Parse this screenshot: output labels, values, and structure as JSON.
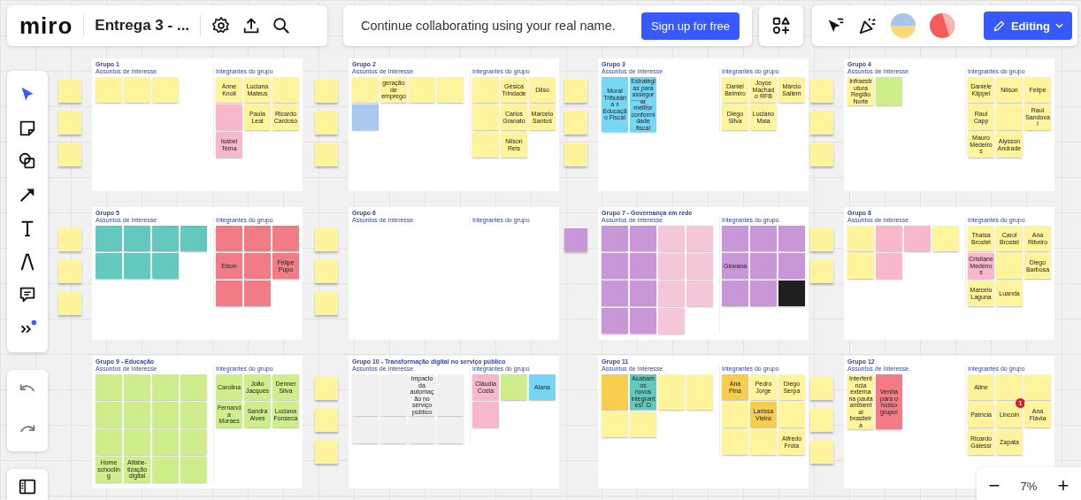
{
  "topbar": {
    "logo": "miro",
    "board_title": "Entrega 3 - ...",
    "banner": "Continue collaborating using your real name.",
    "signup": "Sign up for free",
    "mode": "Editing"
  },
  "frames": [
    {
      "title": "Grupo 1",
      "topics_label": "Assuntos de Interesse",
      "members_label": "Integrantes do grupo",
      "connector": false,
      "side_notes": [
        {
          "color": "#fdf49c"
        },
        {
          "color": "#fdf49c"
        },
        {
          "color": "#fdf49c"
        }
      ],
      "topics": [
        {
          "color": "#fdf49c"
        },
        {
          "color": "#fdf49c"
        },
        {
          "color": "#fdf49c"
        }
      ],
      "members": [
        {
          "text": "Anne Knoll",
          "color": "#fdf49c"
        },
        {
          "text": "Luciana Mateus",
          "color": "#fdf49c"
        },
        {
          "color": "#fdf49c"
        },
        {
          "color": "#f7b8cb"
        },
        {
          "text": "Paula Leal",
          "color": "#fdf49c"
        },
        {
          "text": "Ricardo Cardoso",
          "color": "#fdf49c"
        },
        {
          "text": "Isabel Tema",
          "color": "#f7b8cb"
        }
      ]
    },
    {
      "title": "Grupo 2",
      "topics_label": "Assuntos de Interesse",
      "members_label": "Integrantes do grupo",
      "connector": false,
      "side_notes": [
        {
          "color": "#fdf49c"
        },
        {
          "color": "#fdf49c"
        },
        {
          "color": "#fdf49c"
        }
      ],
      "topics": [
        {
          "color": "#fdf49c"
        },
        {
          "text": "geração de emprego",
          "color": "#fdf49c"
        },
        {
          "color": "#fdf49c"
        },
        {
          "color": "#fdf49c"
        },
        {
          "color": "#a9c9ef"
        }
      ],
      "members": [
        {
          "color": "#fdf49c"
        },
        {
          "text": "Gésica Trindade",
          "color": "#fdf49c"
        },
        {
          "text": "Dilso",
          "color": "#fdf49c"
        },
        {
          "color": "#fdf49c"
        },
        {
          "text": "Carlos Granato",
          "color": "#fdf49c"
        },
        {
          "text": "Marcelo Santos",
          "color": "#fdf49c"
        },
        {
          "color": "#fdf49c"
        },
        {
          "text": "Nilson Reis",
          "color": "#fdf49c"
        }
      ]
    },
    {
      "title": "Grupo 3",
      "topics_label": "Assuntos de Interesse",
      "members_label": "Integrantes do grupo",
      "connector": true,
      "side_notes": [
        {
          "color": "#fdf49c"
        },
        {
          "color": "#fdf49c"
        },
        {
          "color": "#fdf49c"
        }
      ],
      "topics": [
        {
          "text": "Moral Tributária x Educação Fiscal",
          "color": "#76d7f5"
        },
        {
          "text": "Estratégias para assegurar melhor conformidade fiscal",
          "color": "#76d7f5"
        }
      ],
      "members": [
        {
          "text": "Daniel Belmiro",
          "color": "#fdf49c"
        },
        {
          "text": "Joyce Machado RFB",
          "color": "#fdf49c"
        },
        {
          "text": "Márcio Sallem",
          "color": "#fdf49c"
        },
        {
          "text": "Diego Silva",
          "color": "#fdf49c"
        },
        {
          "text": "Luciano Maia",
          "color": "#fdf49c"
        }
      ]
    },
    {
      "title": "Grupo 4",
      "topics_label": "Assuntos de Interesse",
      "members_label": "Integrantes do grupo",
      "connector": false,
      "side_notes": [
        {
          "color": "#fdf49c"
        },
        {
          "color": "#fdf49c"
        },
        {
          "color": "#fdf49c"
        }
      ],
      "topics": [
        {
          "text": "Infraestrutura Região Norte",
          "color": "#fdf49c"
        },
        {
          "color": "#cdee8a"
        }
      ],
      "members": [
        {
          "text": "Daniele Klippel",
          "color": "#fdf49c"
        },
        {
          "text": "Nilson",
          "color": "#fdf49c"
        },
        {
          "text": "Felipe",
          "color": "#fdf49c"
        },
        {
          "text": "Raul Capp",
          "color": "#fdf49c"
        },
        {
          "color": "#fdf49c"
        },
        {
          "text": "Raul Sandoval",
          "color": "#fdf49c"
        },
        {
          "text": "Mauro Medeiros",
          "color": "#fdf49c"
        },
        {
          "text": "Alysson Andrade",
          "color": "#fdf49c"
        }
      ]
    },
    {
      "title": "Grupo 5",
      "topics_label": "Assuntos de Interesse",
      "members_label": "Integrantes do grupo",
      "connector": false,
      "side_notes": [
        {
          "color": "#fdf49c"
        },
        {
          "color": "#fdf49c"
        },
        {
          "color": "#fdf49c"
        }
      ],
      "topics": [
        {
          "color": "#63c9bf"
        },
        {
          "color": "#63c9bf"
        },
        {
          "color": "#63c9bf"
        },
        {
          "color": "#63c9bf"
        },
        {
          "color": "#63c9bf"
        },
        {
          "color": "#63c9bf"
        },
        {
          "color": "#63c9bf"
        }
      ],
      "members": [
        {
          "color": "#f17c86"
        },
        {
          "color": "#f17c86"
        },
        {
          "color": "#f17c86"
        },
        {
          "text": "Elson",
          "color": "#f17c86"
        },
        {
          "color": "#f17c86"
        },
        {
          "text": "Felipe Pupo",
          "color": "#f17c86"
        },
        {
          "color": "#f17c86"
        },
        {
          "color": "#f17c86"
        }
      ]
    },
    {
      "title": "Grupo 6",
      "topics_label": "Assuntos de Interesse",
      "members_label": "Integrantes do grupo",
      "connector": false,
      "side_notes": [
        {
          "color": "#fdf49c"
        },
        {
          "color": "#fdf49c"
        },
        {
          "color": "#fdf49c"
        }
      ]
    },
    {
      "title": "Grupo 7 - Governança em rede",
      "topics_label": "Assuntos de Interesse",
      "members_label": "Integrantes do grupo",
      "connector": false,
      "side_notes": [
        {
          "color": "#c996d8"
        }
      ],
      "topics": [
        {
          "color": "#c996d8"
        },
        {
          "color": "#c996d8"
        },
        {
          "color": "#f5c6d8"
        },
        {
          "color": "#f5c6d8"
        },
        {
          "color": "#c996d8"
        },
        {
          "color": "#c996d8"
        },
        {
          "color": "#f5c6d8"
        },
        {
          "color": "#f5c6d8"
        },
        {
          "color": "#c996d8"
        },
        {
          "color": "#c996d8"
        },
        {
          "color": "#f5c6d8"
        },
        {
          "color": "#f5c6d8"
        },
        {
          "color": "#c996d8"
        },
        {
          "color": "#c996d8"
        },
        {
          "color": "#f5c6d8"
        }
      ],
      "members": [
        {
          "color": "#c996d8"
        },
        {
          "color": "#c996d8"
        },
        {
          "color": "#c996d8"
        },
        {
          "text": "Giovana",
          "color": "#c996d8"
        },
        {
          "color": "#c996d8"
        },
        {
          "color": "#c996d8"
        },
        {
          "color": "#c996d8"
        },
        {
          "color": "#c996d8"
        },
        {
          "color": "#1f1f1f"
        }
      ]
    },
    {
      "title": "Grupo 8",
      "topics_label": "Assuntos de Interesse",
      "members_label": "Integrantes do grupo",
      "connector": false,
      "side_notes": [
        {
          "color": "#fdf49c"
        },
        {
          "color": "#fdf49c"
        }
      ],
      "topics": [
        {
          "color": "#fdf49c"
        },
        {
          "color": "#f7b8cb"
        },
        {
          "color": "#f7b8cb"
        },
        {
          "color": "#fdf49c"
        },
        {
          "color": "#fdf49c"
        },
        {
          "color": "#f7b8cb"
        }
      ],
      "members": [
        {
          "text": "Thaísa Brostel",
          "color": "#fdf49c"
        },
        {
          "text": "Carol Brostel",
          "color": "#fdf49c"
        },
        {
          "text": "Ana Ribeiro",
          "color": "#fdf49c"
        },
        {
          "text": "Cristiane Medeiros",
          "color": "#f7b8cb"
        },
        {
          "color": "#fdf49c"
        },
        {
          "text": "Diego Barbosa",
          "color": "#fdf49c"
        },
        {
          "text": "Marcelo Laguna",
          "color": "#fdf49c"
        },
        {
          "text": "Luanda",
          "color": "#fdf49c"
        }
      ]
    },
    {
      "title": "Grupo 9 - Educação",
      "topics_label": "Assuntos de Interesse",
      "members_label": "Integrantes do grupo",
      "connector": false,
      "topics": [
        {
          "color": "#cdee8a"
        },
        {
          "color": "#cdee8a"
        },
        {
          "color": "#cdee8a"
        },
        {
          "color": "#cdee8a"
        },
        {
          "color": "#cdee8a"
        },
        {
          "color": "#cdee8a"
        },
        {
          "color": "#cdee8a"
        },
        {
          "color": "#cdee8a"
        },
        {
          "color": "#cdee8a"
        },
        {
          "color": "#cdee8a"
        },
        {
          "color": "#cdee8a"
        },
        {
          "color": "#cdee8a"
        },
        {
          "text": "Home schooling",
          "color": "#cdee8a"
        },
        {
          "text": "Alfabe-tização digital",
          "color": "#cdee8a"
        },
        {
          "color": "#cdee8a"
        },
        {
          "color": "#cdee8a"
        }
      ],
      "members": [
        {
          "text": "Carolina",
          "color": "#cdee8a"
        },
        {
          "text": "João Jacques",
          "color": "#cdee8a"
        },
        {
          "text": "Denner Silva",
          "color": "#cdee8a"
        },
        {
          "text": "Fernanda Moraes",
          "color": "#cdee8a"
        },
        {
          "text": "Sandra Alves",
          "color": "#cdee8a"
        },
        {
          "text": "Luciana Fonseca",
          "color": "#cdee8a"
        }
      ]
    },
    {
      "title": "Grupo 10 - Transformação digital no serviço público",
      "topics_label": "Assuntos de Interesse",
      "members_label": "Integrantes do grupo",
      "connector": false,
      "side_notes": [
        {
          "color": "#fdf49c"
        },
        {
          "color": "#fdf49c"
        },
        {
          "color": "#fdf49c"
        }
      ],
      "topics": [
        {
          "color": "#f0f0f0"
        },
        {
          "color": "#f0f0f0"
        },
        {
          "text": "Impacto da automação no serviço público",
          "color": "#f0f0f0"
        },
        {
          "color": "#f0f0f0"
        },
        {
          "color": "#f0f0f0"
        },
        {
          "color": "#f0f0f0"
        },
        {
          "color": "#f0f0f0"
        },
        {
          "color": "#f0f0f0"
        }
      ],
      "members": [
        {
          "text": "Cláudia Costa",
          "color": "#f7b8cb"
        },
        {
          "color": "#cdee8a"
        },
        {
          "text": "Alana",
          "color": "#76d7f5"
        },
        {
          "color": "#f7b8cb"
        }
      ]
    },
    {
      "title": "Grupo 11",
      "topics_label": "Assuntos de Interesse",
      "members_label": "Integrantes do grupo",
      "connector": false,
      "topics": [
        {
          "color": "#f6cd4c"
        },
        {
          "text": "Acabamos novos integrantes! :D",
          "color": "#63c9bf"
        },
        {
          "color": "#fdf49c"
        },
        {
          "color": "#fdf49c"
        },
        {
          "color": "#fdf49c"
        },
        {
          "color": "#fdf49c"
        }
      ],
      "members": [
        {
          "text": "Ana Pina",
          "color": "#f6cd4c"
        },
        {
          "text": "Pedro Jorge",
          "color": "#fdf49c"
        },
        {
          "text": "Diego Serpa",
          "color": "#fdf49c"
        },
        {
          "color": "#fdf49c"
        },
        {
          "text": "Larissa Vieira",
          "color": "#f6cd4c"
        },
        {
          "color": "#fdf49c"
        },
        {
          "color": "#fdf49c"
        },
        {
          "color": "#fdf49c"
        },
        {
          "text": "Alfredo Frota",
          "color": "#fdf49c"
        }
      ]
    },
    {
      "title": "Grupo 12",
      "topics_label": "Assuntos de Interesse",
      "members_label": "Integrantes do grupo",
      "connector": false,
      "side_notes": [
        {
          "color": "#fdf49c"
        },
        {
          "color": "#fdf49c"
        },
        {
          "color": "#fdf49c"
        }
      ],
      "topics": [
        {
          "text": "Interferência externa na pauta ambiental brasileira",
          "color": "#fdf49c"
        },
        {
          "text": "Venha para o nosso grupo!",
          "color": "#f17c86"
        }
      ],
      "members": [
        {
          "text": "Aline",
          "color": "#fdf49c"
        },
        {
          "color": "#fdf49c"
        },
        {
          "color": "#fdf49c"
        },
        {
          "text": "Patrícia",
          "color": "#fdf49c"
        },
        {
          "text": "Lincoln",
          "color": "#fdf49c",
          "comments": "1"
        },
        {
          "text": "Ana Flávia",
          "color": "#fdf49c"
        },
        {
          "text": "Ricardo Galessi",
          "color": "#fdf49c"
        },
        {
          "text": "Zapata",
          "color": "#fdf49c"
        }
      ]
    }
  ],
  "zoom": {
    "minus": "−",
    "value": "7%",
    "plus": "+"
  }
}
